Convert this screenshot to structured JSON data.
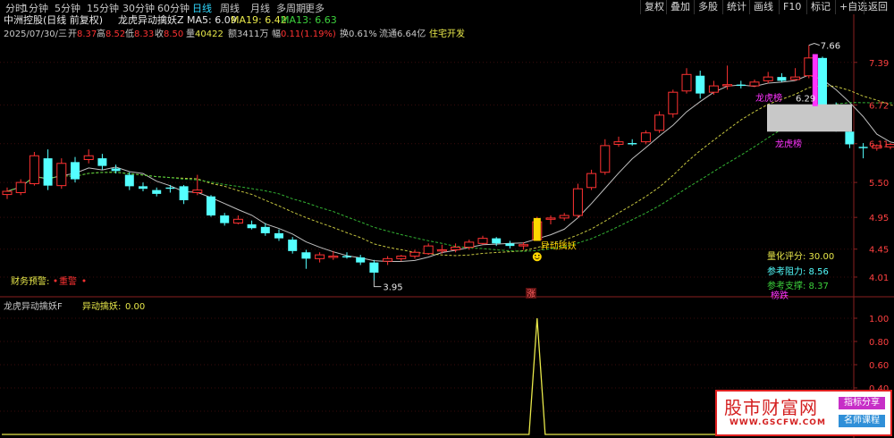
{
  "toolbar": {
    "timeframes": [
      "分时",
      "1分钟",
      "5分钟",
      "15分钟",
      "30分钟",
      "60分钟",
      "日线",
      "周线",
      "月线",
      "多周期",
      "更多"
    ],
    "active_timeframe": "日线",
    "right_buttons": [
      "复权",
      "叠加",
      "多股",
      "统计",
      "画线",
      "F10",
      "标记",
      "+自选",
      "返回"
    ]
  },
  "header": {
    "stock": "中洲控股(日线 前复权)",
    "indicator_name": "龙虎异动擒妖Z",
    "ma5": "MA5: 6.09",
    "ma19": "MA19: 6.42",
    "ma13": "MA13: 6.63",
    "date": "2025/07/30/三",
    "open_label": "开",
    "open": "8.37",
    "high_label": "高",
    "high": "8.52",
    "low_label": "低",
    "low": "8.33",
    "close_label": "收",
    "close": "8.50",
    "volume_label": "量",
    "volume": "40422",
    "amount_label": "额",
    "amount": "3411万",
    "change_label": "幅",
    "change": "0.11(1.19%)",
    "turnover": "换0.61%",
    "float": "流通6.64亿",
    "sector": "住宅开发"
  },
  "labels": {
    "warning": "财务预警:",
    "warning_value": "重警",
    "yidong": "异动擒妖",
    "zhang": "涨",
    "longhu_a": "龙虎榜",
    "longhu_b": "龙虎榜",
    "bang_die": "榜跌",
    "score": "量化评分: 30.00",
    "resist": "参考阻力: 8.56",
    "support": "参考支撑: 8.37",
    "high_mark": "7.66",
    "low_mark": "3.95",
    "zone_value": "6.29"
  },
  "lower_panel": {
    "title": "龙虎异动擒妖F",
    "series_label": "异动擒妖:",
    "value": "0.00"
  },
  "watermark": {
    "title": "股市财富网",
    "url": "WWW.GSCFW.COM",
    "tag1": "指标分享",
    "tag2": "名师课程"
  },
  "colors": {
    "up": "#ff3232",
    "down": "#54ffff",
    "ma5": "#e0e0e0",
    "ma_mid": "#e8e84a",
    "ma_long": "#3cd23c",
    "spike": "#e8e84a",
    "highlight_yellow": "#ffd700",
    "magenta": "#ff33ff"
  },
  "chart_data": {
    "type": "candlestick",
    "price_axis": {
      "ticks": [
        7.39,
        6.72,
        6.11,
        5.5,
        4.95,
        4.45,
        4.01
      ],
      "ylim": [
        3.7,
        7.95
      ]
    },
    "candles": [
      {
        "o": 5.31,
        "h": 5.42,
        "l": 5.24,
        "c": 5.36
      },
      {
        "o": 5.34,
        "h": 5.55,
        "l": 5.3,
        "c": 5.5
      },
      {
        "o": 5.48,
        "h": 5.98,
        "l": 5.45,
        "c": 5.92
      },
      {
        "o": 5.88,
        "h": 6.02,
        "l": 5.38,
        "c": 5.45
      },
      {
        "o": 5.45,
        "h": 5.88,
        "l": 5.4,
        "c": 5.8
      },
      {
        "o": 5.82,
        "h": 5.9,
        "l": 5.5,
        "c": 5.55
      },
      {
        "o": 5.86,
        "h": 6.02,
        "l": 5.8,
        "c": 5.92
      },
      {
        "o": 5.88,
        "h": 5.95,
        "l": 5.7,
        "c": 5.76
      },
      {
        "o": 5.72,
        "h": 5.78,
        "l": 5.64,
        "c": 5.68
      },
      {
        "o": 5.62,
        "h": 5.66,
        "l": 5.38,
        "c": 5.44
      },
      {
        "o": 5.44,
        "h": 5.5,
        "l": 5.36,
        "c": 5.4
      },
      {
        "o": 5.38,
        "h": 5.42,
        "l": 5.28,
        "c": 5.32
      },
      {
        "o": 5.42,
        "h": 5.46,
        "l": 5.34,
        "c": 5.4
      },
      {
        "o": 5.44,
        "h": 5.46,
        "l": 5.16,
        "c": 5.22
      },
      {
        "o": 5.34,
        "h": 5.62,
        "l": 5.3,
        "c": 5.38
      },
      {
        "o": 5.28,
        "h": 5.3,
        "l": 4.96,
        "c": 4.98
      },
      {
        "o": 4.98,
        "h": 5.02,
        "l": 4.82,
        "c": 4.86
      },
      {
        "o": 4.86,
        "h": 4.98,
        "l": 4.84,
        "c": 4.92
      },
      {
        "o": 4.84,
        "h": 4.9,
        "l": 4.76,
        "c": 4.78
      },
      {
        "o": 4.8,
        "h": 4.86,
        "l": 4.66,
        "c": 4.7
      },
      {
        "o": 4.7,
        "h": 4.76,
        "l": 4.58,
        "c": 4.62
      },
      {
        "o": 4.6,
        "h": 4.64,
        "l": 4.38,
        "c": 4.42
      },
      {
        "o": 4.4,
        "h": 4.44,
        "l": 4.14,
        "c": 4.3
      },
      {
        "o": 4.3,
        "h": 4.4,
        "l": 4.24,
        "c": 4.36
      },
      {
        "o": 4.32,
        "h": 4.42,
        "l": 4.28,
        "c": 4.34
      },
      {
        "o": 4.34,
        "h": 4.4,
        "l": 4.3,
        "c": 4.32
      },
      {
        "o": 4.32,
        "h": 4.36,
        "l": 4.2,
        "c": 4.24
      },
      {
        "o": 4.24,
        "h": 4.28,
        "l": 3.96,
        "c": 4.08
      },
      {
        "o": 4.26,
        "h": 4.34,
        "l": 4.2,
        "c": 4.3
      },
      {
        "o": 4.3,
        "h": 4.36,
        "l": 4.26,
        "c": 4.34
      },
      {
        "o": 4.34,
        "h": 4.44,
        "l": 4.3,
        "c": 4.4
      },
      {
        "o": 4.38,
        "h": 4.54,
        "l": 4.36,
        "c": 4.5
      },
      {
        "o": 4.42,
        "h": 4.52,
        "l": 4.38,
        "c": 4.44
      },
      {
        "o": 4.44,
        "h": 4.54,
        "l": 4.4,
        "c": 4.48
      },
      {
        "o": 4.48,
        "h": 4.6,
        "l": 4.44,
        "c": 4.56
      },
      {
        "o": 4.54,
        "h": 4.66,
        "l": 4.52,
        "c": 4.62
      },
      {
        "o": 4.62,
        "h": 4.64,
        "l": 4.5,
        "c": 4.54
      },
      {
        "o": 4.54,
        "h": 4.58,
        "l": 4.46,
        "c": 4.5
      },
      {
        "o": 4.5,
        "h": 4.56,
        "l": 4.44,
        "c": 4.52
      },
      {
        "o": 4.6,
        "h": 4.96,
        "l": 4.58,
        "c": 4.88
      },
      {
        "o": 4.92,
        "h": 4.98,
        "l": 4.84,
        "c": 4.94
      },
      {
        "o": 4.94,
        "h": 5.02,
        "l": 4.9,
        "c": 4.98
      },
      {
        "o": 4.98,
        "h": 5.48,
        "l": 4.94,
        "c": 5.4
      },
      {
        "o": 5.42,
        "h": 5.7,
        "l": 5.38,
        "c": 5.64
      },
      {
        "o": 5.66,
        "h": 6.18,
        "l": 5.62,
        "c": 6.08
      },
      {
        "o": 6.1,
        "h": 6.22,
        "l": 6.06,
        "c": 6.14
      },
      {
        "o": 6.12,
        "h": 6.18,
        "l": 6.08,
        "c": 6.1
      },
      {
        "o": 6.14,
        "h": 6.32,
        "l": 6.1,
        "c": 6.28
      },
      {
        "o": 6.32,
        "h": 6.62,
        "l": 6.28,
        "c": 6.56
      },
      {
        "o": 6.58,
        "h": 6.96,
        "l": 6.52,
        "c": 6.92
      },
      {
        "o": 6.94,
        "h": 7.3,
        "l": 6.9,
        "c": 7.2
      },
      {
        "o": 7.18,
        "h": 7.26,
        "l": 6.82,
        "c": 6.9
      },
      {
        "o": 6.92,
        "h": 7.1,
        "l": 6.88,
        "c": 7.02
      },
      {
        "o": 7.02,
        "h": 7.34,
        "l": 6.96,
        "c": 7.04
      },
      {
        "o": 7.04,
        "h": 7.1,
        "l": 6.98,
        "c": 7.02
      },
      {
        "o": 7.02,
        "h": 7.12,
        "l": 7.0,
        "c": 7.08
      },
      {
        "o": 7.1,
        "h": 7.24,
        "l": 7.06,
        "c": 7.16
      },
      {
        "o": 7.16,
        "h": 7.22,
        "l": 7.08,
        "c": 7.1
      },
      {
        "o": 7.12,
        "h": 7.3,
        "l": 7.1,
        "c": 7.16
      },
      {
        "o": 7.18,
        "h": 7.66,
        "l": 7.14,
        "c": 7.46
      },
      {
        "o": 7.46,
        "h": 7.48,
        "l": 6.7,
        "c": 6.72
      },
      {
        "o": 6.72,
        "h": 6.76,
        "l": 6.3,
        "c": 6.36
      },
      {
        "o": 6.3,
        "h": 6.34,
        "l": 6.04,
        "c": 6.1
      },
      {
        "o": 6.06,
        "h": 6.12,
        "l": 5.88,
        "c": 6.04
      },
      {
        "o": 6.04,
        "h": 6.1,
        "l": 6.0,
        "c": 6.08
      },
      {
        "o": 6.06,
        "h": 6.12,
        "l": 6.02,
        "c": 6.1
      },
      {
        "o": 6.1,
        "h": 6.2,
        "l": 6.06,
        "c": 6.16
      },
      {
        "o": 6.14,
        "h": 6.26,
        "l": 6.12,
        "c": 6.22
      }
    ],
    "spike_series": {
      "name": "异动擒妖",
      "ylim": [
        0,
        1.0
      ],
      "ticks": [
        1.0,
        0.8,
        0.6,
        0.4,
        0.2
      ],
      "spike_index": 39,
      "spike_value": 1.0
    }
  }
}
